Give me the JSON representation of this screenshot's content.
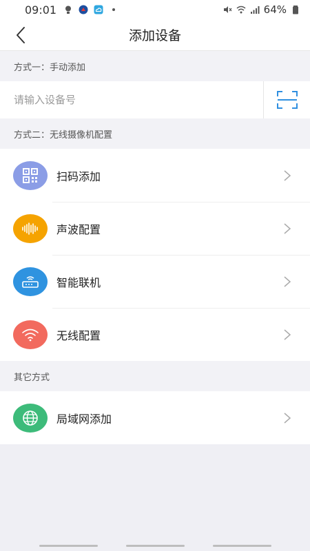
{
  "status_bar": {
    "time": "09:01",
    "battery": "64%"
  },
  "nav": {
    "title": "添加设备"
  },
  "section_manual": {
    "label": "方式一：手动添加",
    "input_placeholder": "请输入设备号"
  },
  "section_wireless": {
    "label": "方式二：无线摄像机配置",
    "items": [
      {
        "label": "扫码添加",
        "icon": "qr-code-icon",
        "color": "#8b9de6"
      },
      {
        "label": "声波配置",
        "icon": "sound-wave-icon",
        "color": "#f5a300"
      },
      {
        "label": "智能联机",
        "icon": "router-icon",
        "color": "#2f93e0"
      },
      {
        "label": "无线配置",
        "icon": "wifi-icon",
        "color": "#f26a5e"
      }
    ]
  },
  "section_other": {
    "label": "其它方式",
    "items": [
      {
        "label": "局域网添加",
        "icon": "globe-icon",
        "color": "#3dbb7a"
      }
    ]
  }
}
